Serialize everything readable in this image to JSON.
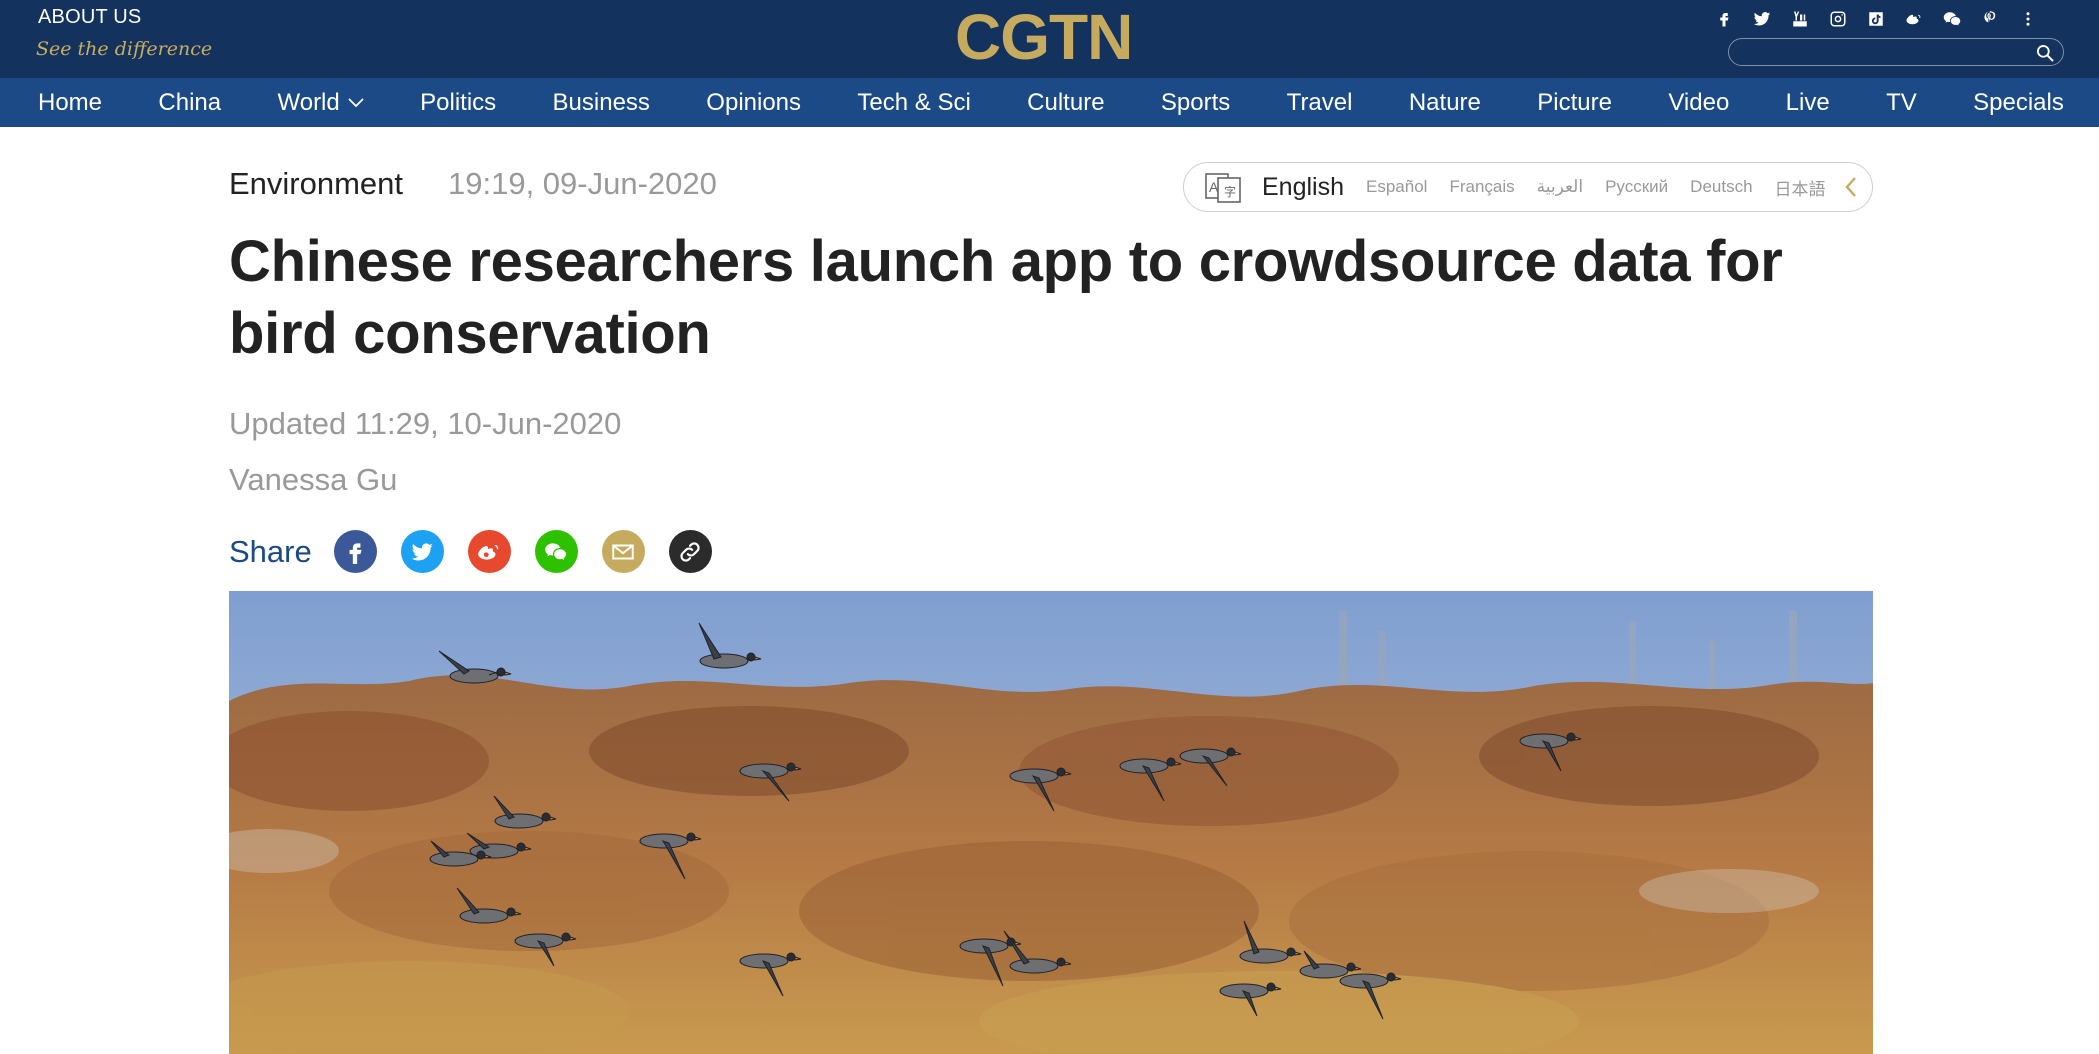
{
  "header": {
    "about_label": "ABOUT US",
    "tagline": "See the difference",
    "logo": "CGTN",
    "brand_color": "#c6ab5e",
    "social_icons": [
      "facebook-icon",
      "twitter-icon",
      "youtube-icon",
      "instagram-icon",
      "tiktok-icon",
      "weibo-icon",
      "wechat-icon",
      "pinterest-icon",
      "more-icon"
    ],
    "search_placeholder": ""
  },
  "nav": {
    "items": [
      "Home",
      "China",
      "World",
      "Politics",
      "Business",
      "Opinions",
      "Tech & Sci",
      "Culture",
      "Sports",
      "Travel",
      "Nature",
      "Picture",
      "Video",
      "Live",
      "TV",
      "Specials"
    ]
  },
  "article": {
    "category": "Environment",
    "date": "19:19, 09-Jun-2020",
    "title": "Chinese researchers launch app to crowdsource data for bird conservation",
    "updated": "Updated 11:29, 10-Jun-2020",
    "author": "Vanessa Gu",
    "share_label": "Share",
    "share_icons": [
      "facebook-icon",
      "twitter-icon",
      "weibo-icon",
      "wechat-icon",
      "email-icon",
      "link-icon"
    ]
  },
  "languages": {
    "active": "English",
    "others": [
      "Español",
      "Français",
      "العربية",
      "Русский",
      "Deutsch",
      "日本語"
    ]
  },
  "colors": {
    "header_bg": "#14325e",
    "nav_bg": "#1b4a86",
    "share_text": "#1b4a86"
  }
}
